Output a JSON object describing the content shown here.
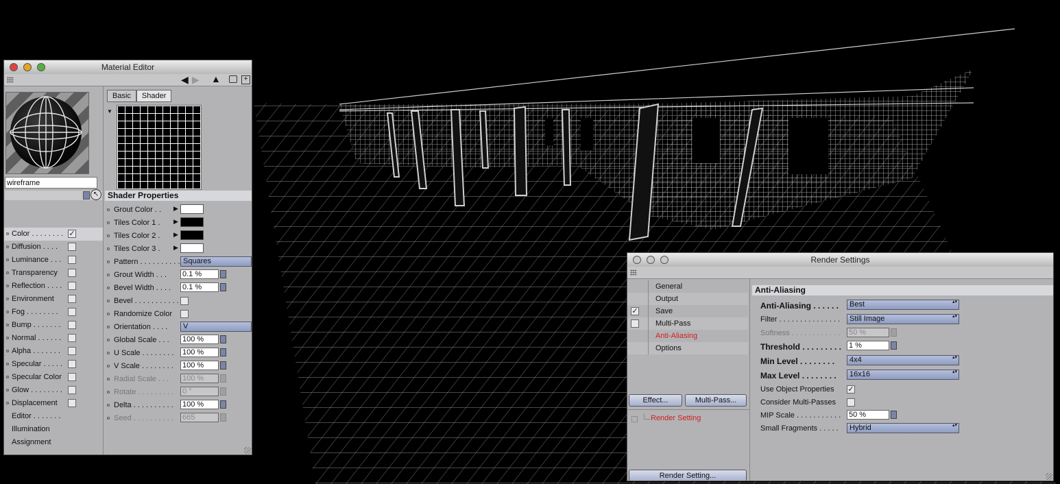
{
  "material_editor": {
    "title": "Material Editor",
    "material_name": "wireframe",
    "tabs": [
      {
        "label": "Basic"
      },
      {
        "label": "Shader"
      }
    ],
    "channels": [
      {
        "label": "Color . . . . . . . .",
        "checked": true,
        "has_checkbox": true
      },
      {
        "label": "Diffusion . . . .",
        "has_checkbox": true
      },
      {
        "label": "Luminance . . .",
        "has_checkbox": true
      },
      {
        "label": "Transparency",
        "has_checkbox": true
      },
      {
        "label": "Reflection . . . .",
        "has_checkbox": true
      },
      {
        "label": "Environment",
        "has_checkbox": true
      },
      {
        "label": "Fog . . . . . . . .",
        "has_checkbox": true
      },
      {
        "label": "Bump . . . . . . .",
        "has_checkbox": true
      },
      {
        "label": "Normal . . . . . .",
        "has_checkbox": true
      },
      {
        "label": "Alpha . . . . . . .",
        "has_checkbox": true
      },
      {
        "label": "Specular . . . . .",
        "has_checkbox": true
      },
      {
        "label": "Specular Color",
        "has_checkbox": true
      },
      {
        "label": "Glow . . . . . . . .",
        "has_checkbox": true
      },
      {
        "label": "Displacement",
        "has_checkbox": true
      },
      {
        "label": "Editor . . . . . . .",
        "has_checkbox": false
      },
      {
        "label": "Illumination",
        "has_checkbox": false
      },
      {
        "label": "Assignment",
        "has_checkbox": false
      }
    ],
    "shader_section_title": "Shader Properties",
    "shader_props": [
      {
        "label": "Grout Color . .",
        "type": "color",
        "color": "#ffffff"
      },
      {
        "label": "Tiles Color 1 .",
        "type": "color",
        "color": "#000000"
      },
      {
        "label": "Tiles Color 2 .",
        "type": "color",
        "color": "#000000"
      },
      {
        "label": "Tiles Color 3 .",
        "type": "color",
        "color": "#ffffff"
      },
      {
        "label": "Pattern . . . . . . . . . .",
        "type": "dropdown",
        "value": "Squares"
      },
      {
        "label": "Grout Width . . .",
        "type": "number",
        "value": "0.1 %"
      },
      {
        "label": "Bevel Width . . . .",
        "type": "number",
        "value": "0.1 %"
      },
      {
        "label": "Bevel . . . . . . . . . . .",
        "type": "checkbox",
        "checked": false
      },
      {
        "label": "Randomize Color",
        "type": "checkbox",
        "checked": false
      },
      {
        "label": "Orientation . . . .",
        "type": "dropdown",
        "value": "V"
      },
      {
        "label": "Global Scale . . .",
        "type": "number",
        "value": "100 %"
      },
      {
        "label": "U Scale . . . . . . . .",
        "type": "number",
        "value": "100 %"
      },
      {
        "label": "V Scale . . . . . . . .",
        "type": "number",
        "value": "100 %"
      },
      {
        "label": "Radial Scale . . .",
        "type": "number",
        "value": "100 %",
        "disabled": true
      },
      {
        "label": "Rotate . . . . . . . . .",
        "type": "number",
        "value": "0 °",
        "disabled": true
      },
      {
        "label": "Delta . . . . . . . . . .",
        "type": "number",
        "value": "100 %"
      },
      {
        "label": "Seed . . . . . . . . . .",
        "type": "number",
        "value": "665",
        "disabled": true
      }
    ]
  },
  "render_settings": {
    "title": "Render Settings",
    "nav": [
      {
        "label": "General"
      },
      {
        "label": "Output"
      },
      {
        "label": "Save",
        "checkbox": true,
        "checked": true
      },
      {
        "label": "Multi-Pass",
        "checkbox": true,
        "checked": false
      },
      {
        "label": "Anti-Aliasing",
        "active": true
      },
      {
        "label": "Options"
      }
    ],
    "effect_button": "Effect...",
    "multipass_button": "Multi-Pass...",
    "tree_item": "Render Setting",
    "render_setting_button": "Render Setting...",
    "section_title": "Anti-Aliasing",
    "props": [
      {
        "label": "Anti-Aliasing . . . . . .",
        "type": "dropdown",
        "value": "Best",
        "bold": true
      },
      {
        "label": "Filter . . . . . . . . . . . . . . .",
        "type": "dropdown",
        "value": "Still Image"
      },
      {
        "label": "Softness . . . . . . . . . . . .",
        "type": "number",
        "value": "50 %",
        "disabled": true
      },
      {
        "label": "Threshold . . . . . . . . .",
        "type": "number",
        "value": "1 %",
        "bold": true
      },
      {
        "label": "Min Level . . . . . . . .",
        "type": "dropdown",
        "value": "4x4",
        "bold": true
      },
      {
        "label": "Max Level . . . . . . . .",
        "type": "dropdown",
        "value": "16x16",
        "bold": true
      },
      {
        "label": "Use Object Properties",
        "type": "checkbox",
        "checked": true
      },
      {
        "label": "Consider Multi-Passes",
        "type": "checkbox",
        "checked": false
      },
      {
        "label": "MIP Scale . . . . . . . . . . .",
        "type": "number",
        "value": "50 %"
      },
      {
        "label": "Small Fragments . . . . .",
        "type": "dropdown",
        "value": "Hybrid"
      }
    ]
  }
}
